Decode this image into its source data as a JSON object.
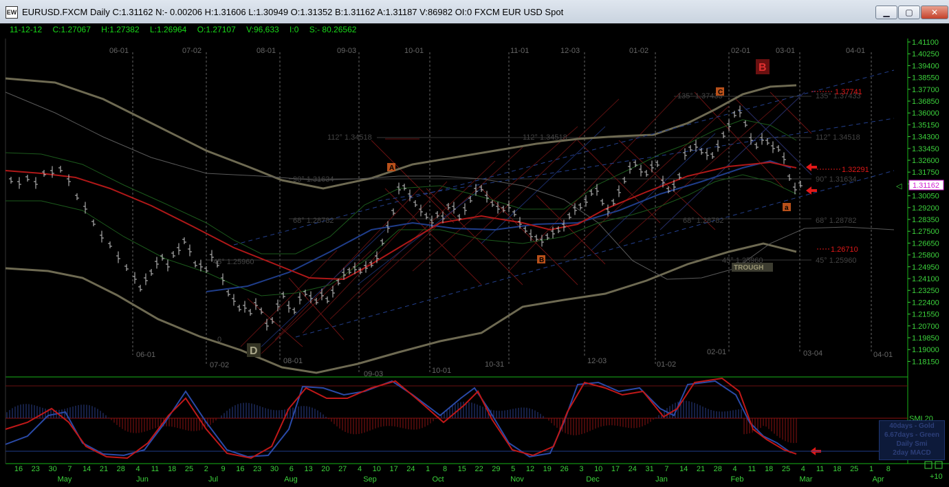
{
  "window": {
    "title": "EURUSD.FXCM Daily C:1.31162 N:- 0.00206 H:1.31606 L:1.30949 O:1.31352 B:1.31162 A:1.31187 V:86982 OI:0 FXCM EUR USD Spot",
    "icon_text": "EW",
    "minimize": "▁",
    "maximize": "▢",
    "close": "✕"
  },
  "info": {
    "date": "11-12-12",
    "close": "C:1.27067",
    "high": "H:1.27382",
    "low": "L:1.26964",
    "open": "O:1.27107",
    "volume": "V:96,633",
    "oi": "I:0",
    "s": "S:- 80.26562"
  },
  "price_axis": [
    "1.41100",
    "1.40250",
    "1.39400",
    "1.38550",
    "1.37700",
    "1.36850",
    "1.36000",
    "1.35150",
    "1.34300",
    "1.33450",
    "1.32600",
    "1.31750",
    "1.30900",
    "1.30050",
    "1.29200",
    "1.28350",
    "1.27500",
    "1.26650",
    "1.25800",
    "1.24950",
    "1.24100",
    "1.23250",
    "1.22400",
    "1.21550",
    "1.20700",
    "1.19850",
    "1.19000",
    "1.18150"
  ],
  "current_price": "1.31162",
  "top_dates": [
    "06-01",
    "07-02",
    "08-01",
    "09-03",
    "10-01",
    "11-01",
    "12-03",
    "01-02",
    "02-01",
    "03-01",
    "04-01"
  ],
  "bottom_dates": [
    "06-01",
    "07-02",
    "08-01",
    "09-03",
    "10-01",
    "10-31",
    "12-03",
    "01-02",
    "02-01",
    "03-04",
    "04-01"
  ],
  "angle_labels": {
    "a135_1": "135° 1.37433",
    "a135_2": "135° 1.37433",
    "a112_1": "112° 1.34518",
    "a112_2": "112° 1.34518",
    "a112_3": "112° 1.34518",
    "a90_1": "90° 1.31634",
    "a90_2": "90° 1.31634",
    "a68_1": "68° 1.28782",
    "a68_2": "68° 1.28782",
    "a68_3": "68° 1.28782",
    "a45_1": "45° 1.25960",
    "a45_2": "45° 1.25960",
    "a45_3": "45° 1.25960",
    "zero": "0"
  },
  "levels": {
    "l1": "1.37741",
    "l2": "1.32291",
    "l3": "1.26710"
  },
  "markers": {
    "A": "A",
    "B": "B",
    "C": "C",
    "a": "a",
    "D": "D",
    "Bbig": "B",
    "trough": "TROUGH"
  },
  "osc_label": "SMI 20",
  "legend": [
    "40days - Gold",
    "6.67days - Green",
    "Daily Smi",
    "2day MACD"
  ],
  "x_days": [
    "16",
    "23",
    "30",
    "7",
    "14",
    "21",
    "28",
    "4",
    "11",
    "18",
    "25",
    "2",
    "9",
    "16",
    "23",
    "30",
    "6",
    "13",
    "20",
    "27",
    "4",
    "10",
    "17",
    "24",
    "1",
    "8",
    "15",
    "22",
    "29",
    "5",
    "12",
    "19",
    "26",
    "3",
    "10",
    "17",
    "24",
    "31",
    "7",
    "14",
    "21",
    "28",
    "4",
    "11",
    "18",
    "25",
    "4",
    "11",
    "18",
    "25",
    "1",
    "8"
  ],
  "x_months": [
    "May",
    "Jun",
    "Jul",
    "Aug",
    "Sep",
    "Oct",
    "Nov",
    "Dec",
    "Jan",
    "Feb",
    "Mar",
    "Apr"
  ],
  "zoom": "+10",
  "colors": {
    "grid_text": "#3cd23c",
    "price_bar": "#c8c8c8",
    "red_ma": "#b01818",
    "gold_band": "#6e6a52",
    "blue_line": "#1f3d8a",
    "green_band": "#1c5a1c"
  }
}
